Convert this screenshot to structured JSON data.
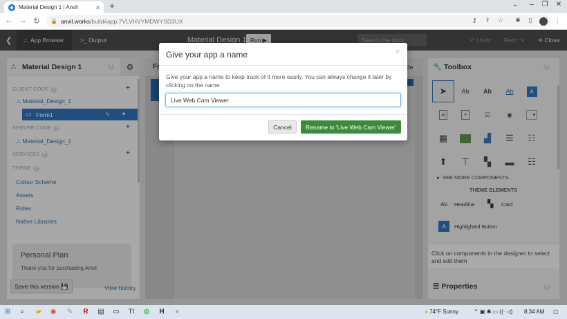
{
  "browser": {
    "tab_title": "Material Design 1 | Anvil",
    "tab_close": "×",
    "new_tab": "+",
    "url_host": "anvil.works",
    "url_path": "/build#app:7VLVHVYMDWYSD3UX",
    "icons": [
      "back-icon",
      "forward-icon",
      "reload-icon",
      "lock-icon",
      "key-icon",
      "share-icon",
      "star-icon",
      "extensions-icon",
      "sidepanel-icon",
      "menu-icon"
    ]
  },
  "header": {
    "app_browser": "App Browser",
    "output": "Output",
    "app_title": "Material Design 1",
    "run": "Run",
    "search_placeholder": "Search the docs",
    "undo": "Undo",
    "redo": "Redo",
    "close": "Close"
  },
  "left_panel": {
    "title": "Material Design 1",
    "client_code": "CLIENT CODE",
    "client_items": [
      "Material_Design_1",
      "Form1"
    ],
    "server_code": "SERVER CODE",
    "server_items": [
      "Material_Design_1"
    ],
    "services": "SERVICES",
    "theme": "THEME",
    "theme_items": [
      "Colour Scheme",
      "Assets",
      "Roles",
      "Native Libraries"
    ],
    "plan_title": "Personal Plan",
    "plan_text": "Thank-you for purchasing Anvil.",
    "save_version": "Save this version",
    "view_history": "View history"
  },
  "center": {
    "tab_prefix": "Fo",
    "tab_suffix": "de"
  },
  "toolbox": {
    "title": "Toolbox",
    "labels": [
      "Ab",
      "Ab",
      "Ab",
      "A"
    ],
    "see_more": "SEE MORE COMPONENTS...",
    "theme_elements": "THEME ELEMENTS",
    "headline": "Headline",
    "card": "Card",
    "highlighted_button": "Highlighted Button",
    "hint": "Click on components in the designer to select and edit them",
    "properties": "Properties"
  },
  "modal": {
    "title": "Give your app a name",
    "close": "×",
    "body": "Give your app a name to keep track of it more easily. You can always change it later by clicking on the name.",
    "input_value": "Live Web Cam Viewer",
    "cancel": "Cancel",
    "rename": "Rename to 'Live Web Cam Viewer'"
  },
  "taskbar": {
    "weather": "74°F  Sunny",
    "time": "8:34 AM"
  }
}
